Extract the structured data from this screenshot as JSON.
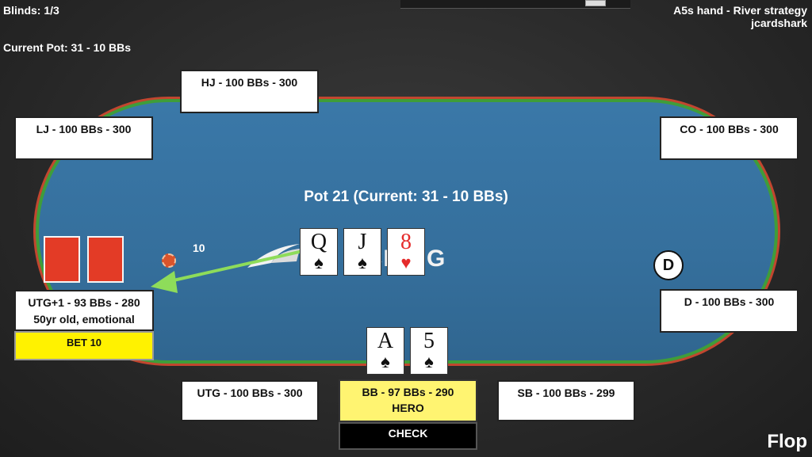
{
  "hud": {
    "blinds": "Blinds: 1/3",
    "current_pot": "Current Pot: 31 - 10 BBs",
    "title_line1": "A5s hand - River strategy",
    "title_line2": "jcardshark",
    "street": "Flop"
  },
  "table": {
    "pot_label": "Pot 21 (Current: 31 - 10 BBs)",
    "logo_text": "ACHING",
    "dealer_button": "D",
    "chip_amount": "10",
    "colors": {
      "felt": "#3a78a8",
      "rail": "#c2462f",
      "rail_inner": "#3f9d3a"
    }
  },
  "board": [
    {
      "rank": "Q",
      "suit": "♠",
      "color": "black"
    },
    {
      "rank": "J",
      "suit": "♠",
      "color": "black"
    },
    {
      "rank": "8",
      "suit": "♥",
      "color": "red"
    }
  ],
  "hero_cards": [
    {
      "rank": "A",
      "suit": "♠",
      "color": "black"
    },
    {
      "rank": "5",
      "suit": "♠",
      "color": "black"
    }
  ],
  "seats": {
    "hj": "HJ - 100 BBs - 300",
    "lj": "LJ - 100 BBs - 300",
    "co": "CO - 100 BBs - 300",
    "d": "D - 100 BBs - 300",
    "utg": "UTG - 100 BBs - 300",
    "sb": "SB - 100 BBs - 299",
    "utg1": "UTG+1 - 93 BBs - 280",
    "utg1_note": "50yr old, emotional",
    "bb": "BB - 97 BBs - 290",
    "bb_note": "HERO"
  },
  "actions": {
    "utg1_action": "BET 10",
    "hero_action": "CHECK"
  }
}
